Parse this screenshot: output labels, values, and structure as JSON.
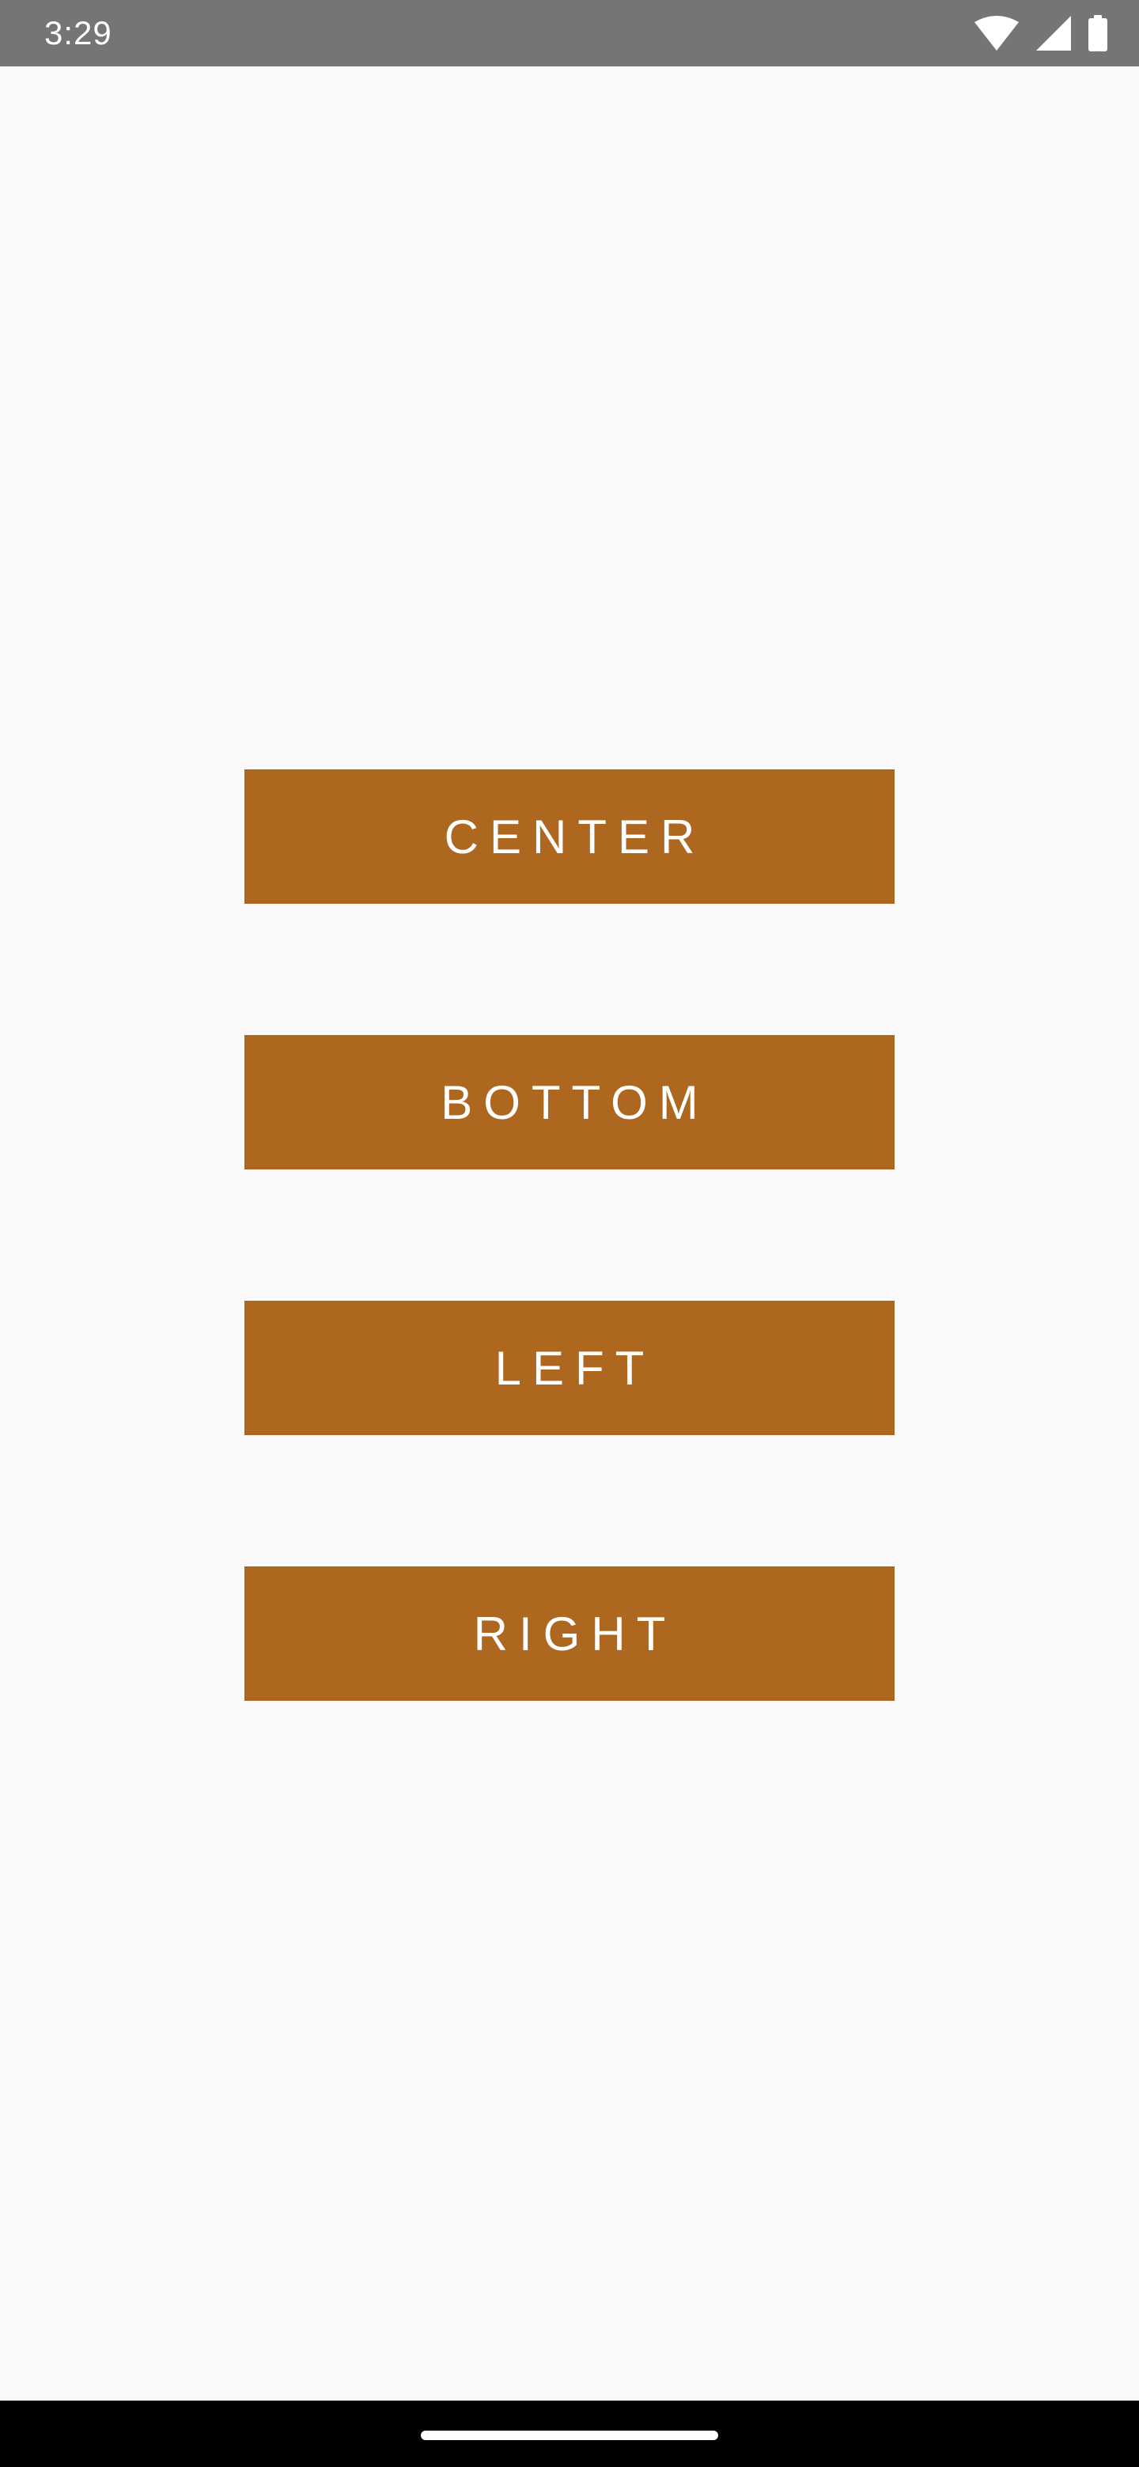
{
  "status_bar": {
    "time": "3:29",
    "icons": [
      "wifi-icon",
      "cellular-signal-icon",
      "battery-icon"
    ]
  },
  "buttons": [
    {
      "id": "center",
      "label": "CENTER"
    },
    {
      "id": "bottom",
      "label": "BOTTOM"
    },
    {
      "id": "left",
      "label": "LEFT"
    },
    {
      "id": "right",
      "label": "RIGHT"
    }
  ],
  "colors": {
    "button_background": "#ad671f",
    "button_text": "#ffffff",
    "page_background": "#fafafa",
    "status_bar_background": "#757575",
    "nav_bar_background": "#000000"
  }
}
